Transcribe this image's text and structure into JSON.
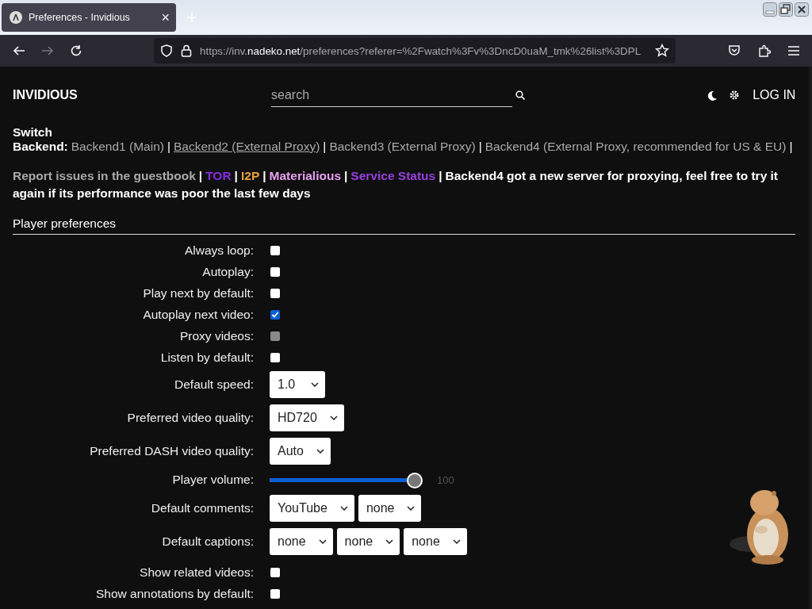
{
  "browser": {
    "tab_title": "Preferences - Invidious",
    "tab_close": "×",
    "url_prefix": "https://inv.",
    "url_domain": "nadeko.net",
    "url_rest": "/preferences?referer=%2Fwatch%3Fv%3DncD0uaM_tmk%26list%3DPL"
  },
  "header": {
    "logo": "INVIDIOUS",
    "search": {
      "placeholder": "search"
    },
    "login": "LOG IN"
  },
  "backends": {
    "label": "Switch Backend:",
    "separator": "|",
    "items": [
      {
        "text": "Backend1 (Main)",
        "selected": false
      },
      {
        "text": "Backend2 (External Proxy)",
        "selected": true
      },
      {
        "text": "Backend3 (External Proxy)",
        "selected": false
      },
      {
        "text": "Backend4 (External Proxy, recommended for US & EU)",
        "selected": false
      }
    ]
  },
  "notice": {
    "separator": "|",
    "links": [
      {
        "text": "Report issues in the guestbook",
        "color": "#a9a9a9"
      },
      {
        "text": "TOR",
        "color": "#8a2be2"
      },
      {
        "text": "I2P",
        "color": "#e8a33d"
      },
      {
        "text": "Materialious",
        "color": "#e7a0f0"
      },
      {
        "text": "Service Status",
        "color": "#9a3fe0"
      }
    ],
    "message_lines": [
      "Backend4 got a new server for proxying, feel free to try it",
      "again if its performance was poor the last few days"
    ]
  },
  "section": {
    "title": "Player preferences"
  },
  "prefs": [
    {
      "kind": "checkbox",
      "label": "Always loop:",
      "checked": false,
      "disabled": false
    },
    {
      "kind": "checkbox",
      "label": "Autoplay:",
      "checked": false,
      "disabled": false
    },
    {
      "kind": "checkbox",
      "label": "Play next by default:",
      "checked": false,
      "disabled": false
    },
    {
      "kind": "checkbox",
      "label": "Autoplay next video:",
      "checked": true,
      "disabled": false
    },
    {
      "kind": "checkbox",
      "label": "Proxy videos:",
      "checked": false,
      "disabled": true
    },
    {
      "kind": "checkbox",
      "label": "Listen by default:",
      "checked": false,
      "disabled": false
    },
    {
      "kind": "select",
      "label": "Default speed:",
      "values": [
        "1.0"
      ]
    },
    {
      "kind": "select",
      "label": "Preferred video quality:",
      "values": [
        "HD720"
      ]
    },
    {
      "kind": "select",
      "label": "Preferred DASH video quality:",
      "values": [
        "Auto"
      ]
    },
    {
      "kind": "slider",
      "label": "Player volume:",
      "level": 1,
      "reading": "100"
    },
    {
      "kind": "select",
      "label": "Default comments:",
      "values": [
        "YouTube",
        "none"
      ]
    },
    {
      "kind": "select",
      "label": "Default captions:",
      "values": [
        "none",
        "none",
        "none"
      ]
    },
    {
      "kind": "checkbox",
      "label": "Show related videos:",
      "checked": false,
      "disabled": false
    },
    {
      "kind": "checkbox",
      "label": "Show annotations by default:",
      "checked": false,
      "disabled": false
    }
  ]
}
